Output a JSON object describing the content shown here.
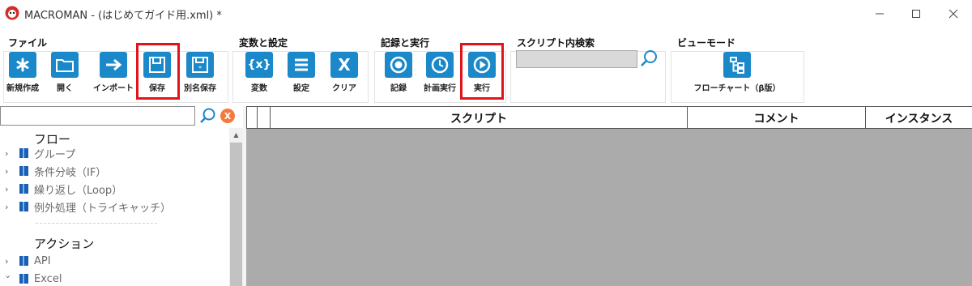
{
  "window": {
    "title": "MACROMAN - (はじめてガイド用.xml) *",
    "controls": {
      "minimize": "—",
      "maximize": "☐",
      "close": "✕"
    }
  },
  "ribbon": {
    "groups": [
      {
        "title": "ファイル"
      },
      {
        "title": "変数と設定"
      },
      {
        "title": "記録と実行"
      },
      {
        "title": "スクリプト内検索"
      },
      {
        "title": "ビューモード"
      }
    ],
    "buttons": {
      "new": {
        "label": "新規作成",
        "icon": "asterisk-icon"
      },
      "open": {
        "label": "開く",
        "icon": "folder-icon"
      },
      "import": {
        "label": "インポート",
        "icon": "arrow-right-icon"
      },
      "save": {
        "label": "保存",
        "icon": "floppy-disk-icon"
      },
      "save_as": {
        "label": "別名保存",
        "icon": "floppy-disk-star-icon"
      },
      "variables": {
        "label": "変数",
        "icon": "curly-x-icon"
      },
      "settings": {
        "label": "設定",
        "icon": "list-icon"
      },
      "clear": {
        "label": "クリア",
        "icon": "x-letter-icon"
      },
      "record": {
        "label": "記録",
        "icon": "record-icon"
      },
      "scheduled_run": {
        "label": "計画実行",
        "icon": "clock-icon"
      },
      "run": {
        "label": "実行",
        "icon": "play-icon"
      },
      "flowchart": {
        "label": "フローチャート（β版）",
        "icon": "flowchart-icon"
      }
    },
    "search": {
      "value": ""
    }
  },
  "sidebar": {
    "search_value": "",
    "clear_label": "X",
    "sections": [
      {
        "title": "フロー",
        "items": [
          "グループ",
          "条件分岐（IF）",
          "繰り返し（Loop）",
          "例外処理（トライキャッチ）"
        ]
      },
      {
        "title": "アクション",
        "items": [
          "API",
          "Excel"
        ]
      }
    ]
  },
  "grid": {
    "columns": [
      "",
      "",
      "スクリプト",
      "コメント",
      "インスタンス"
    ]
  },
  "colors": {
    "accent": "#1a88c9",
    "highlight": "#e0141a",
    "clear_button": "#f47a3c",
    "grid_background": "#ababab"
  }
}
